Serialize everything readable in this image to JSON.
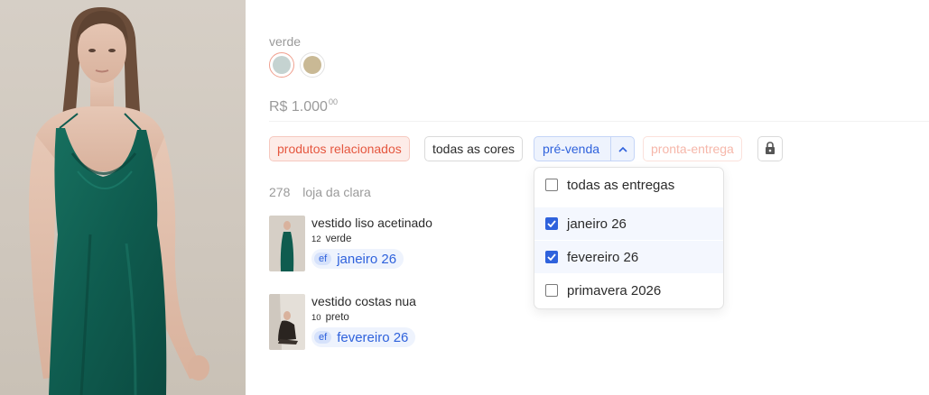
{
  "product": {
    "color_label": "verde",
    "swatches": [
      {
        "name": "verde",
        "color": "#c5d3d1",
        "selected": true
      },
      {
        "name": "bege",
        "color": "#c9b995",
        "selected": false
      }
    ],
    "price_main": "R$ 1.000",
    "price_cents": "00"
  },
  "filters": {
    "related": "produtos relacionados",
    "all_colors": "todas as cores",
    "presale": "pré-venda",
    "ready": "pronta-entrega",
    "lock_icon": "lock-icon",
    "chevron_icon": "chevron-up-icon"
  },
  "store": {
    "count": "278",
    "name": "loja da clara"
  },
  "items": [
    {
      "name": "vestido liso acetinado",
      "qty": "12",
      "color": "verde",
      "tag_prefix": "ef",
      "tag": "janeiro 26"
    },
    {
      "name": "vestido costas nua",
      "qty": "10",
      "color": "preto",
      "tag_prefix": "ef",
      "tag": "fevereiro 26"
    }
  ],
  "dropdown": {
    "options": [
      {
        "label": "todas as entregas",
        "checked": false
      },
      {
        "label": "janeiro 26",
        "checked": true
      },
      {
        "label": "fevereiro 26",
        "checked": true
      },
      {
        "label": "primavera 2026",
        "checked": false
      }
    ]
  },
  "colors": {
    "accent_blue": "#2f62dc",
    "accent_coral": "#e5573f",
    "dress_green": "#0f5c4f"
  }
}
